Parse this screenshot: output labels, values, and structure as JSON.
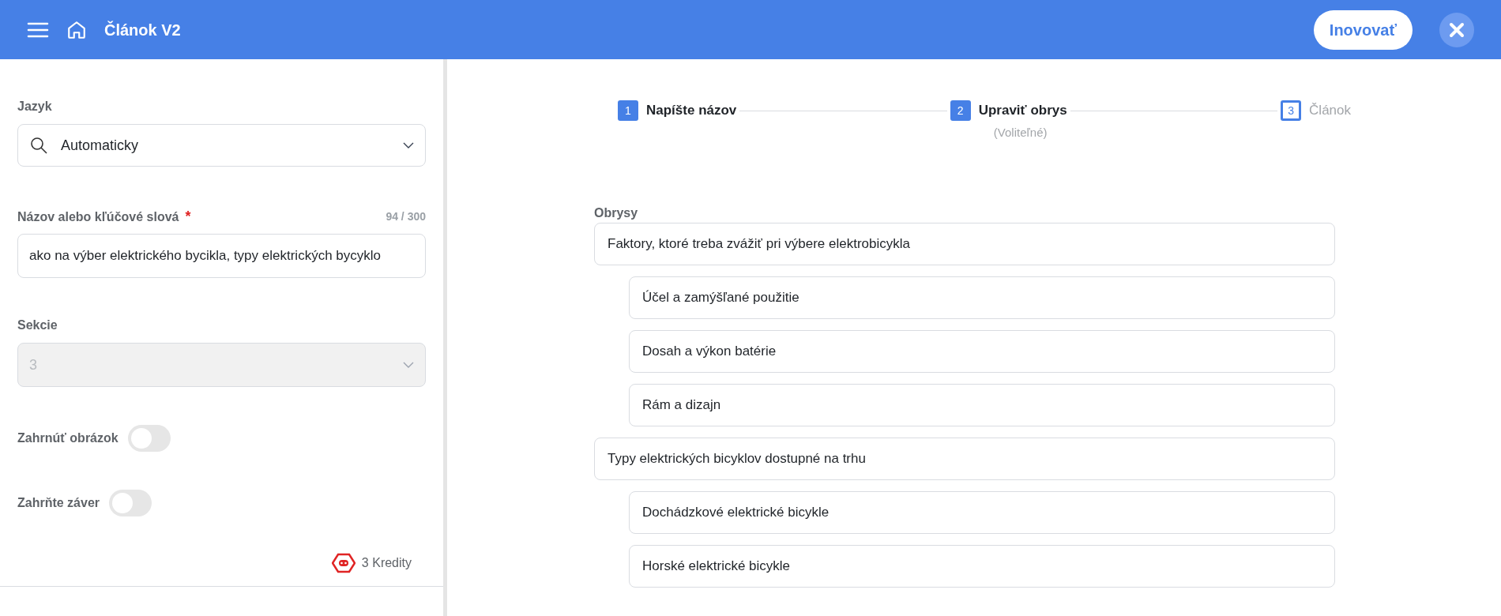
{
  "header": {
    "title": "Článok V2",
    "action_button": "Inovovať"
  },
  "form": {
    "language": {
      "label": "Jazyk",
      "value": "Automaticky"
    },
    "title_field": {
      "label": "Názov alebo kľúčové slová",
      "required_mark": "*",
      "counter": "94 / 300",
      "value": "ako na výber elektrického bycikla, typy elektrických bycyklo"
    },
    "sections": {
      "label": "Sekcie",
      "value": "3",
      "disabled": true
    },
    "toggles": [
      {
        "label": "Zahrnúť obrázok",
        "on": false
      },
      {
        "label": "Zahrňte záver",
        "on": false
      }
    ],
    "credits": "3 Kredity"
  },
  "steps": [
    {
      "number": "1",
      "label": "Napíšte názov",
      "active": true
    },
    {
      "number": "2",
      "label": "Upraviť obrys",
      "note": "(Voliteľné)",
      "active": true
    },
    {
      "number": "3",
      "label": "Článok",
      "active": false
    }
  ],
  "outline": {
    "label": "Obrysy",
    "items": [
      {
        "text": "Faktory, ktoré treba zvážiť pri výbere elektrobicykla",
        "children": [
          {
            "text": "Účel a zamýšľané použitie"
          },
          {
            "text": "Dosah a výkon batérie"
          },
          {
            "text": "Rám a dizajn"
          }
        ]
      },
      {
        "text": "Typy elektrických bicyklov dostupné na trhu",
        "children": [
          {
            "text": "Dochádzkové elektrické bicykle"
          },
          {
            "text": "Horské elektrické bicykle"
          }
        ]
      }
    ]
  }
}
